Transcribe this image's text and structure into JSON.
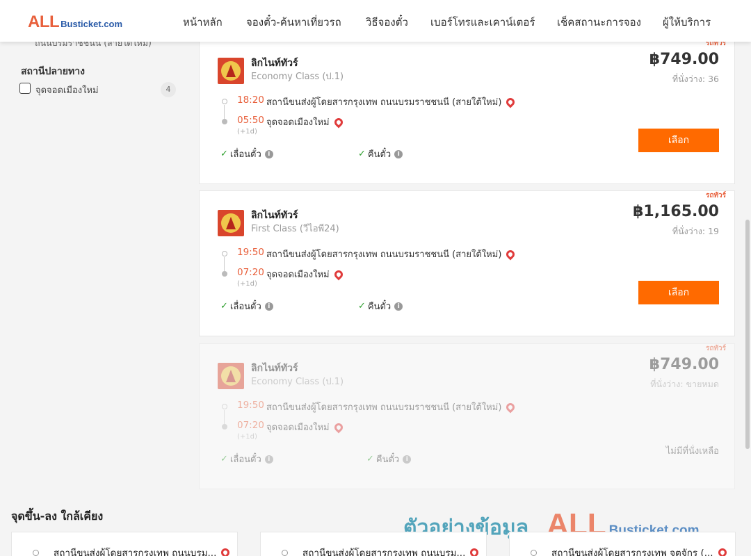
{
  "header": {
    "logo_all": "ALL",
    "logo_rest": "Busticket.com",
    "nav": [
      "หน้าหลัก",
      "จองตั๋ว-ค้นหาเที่ยวรถ",
      "วิธีจองตั๋ว",
      "เบอร์โทรและเคาน์เตอร์",
      "เช็คสถานะการจอง",
      "ผู้ให้บริการ"
    ]
  },
  "sidebar": {
    "cut_text": "ถนนบรมราชชนนี (สายใต้ใหม่)",
    "section_title": "สถานีปลายทาง",
    "option_label": "จุดจอดเมืองใหม่",
    "option_count": "4"
  },
  "trips": [
    {
      "tag": "รถทัวร์",
      "operator": "ลิกไนท์ทัวร์",
      "class": "Economy Class (ป.1)",
      "price": "฿749.00",
      "seats": "ที่นั่งว่าง: 36",
      "dep_time": "18:20",
      "dep_place": "สถานีขนส่งผู้โดยสารกรุงเทพ ถนนบรมราชชนนี (สายใต้ใหม่)",
      "arr_time": "05:50",
      "arr_place": "จุดจอดเมืองใหม่",
      "plus_day": "(+1d)",
      "feature_1": "เลื่อนตั๋ว",
      "feature_2": "คืนตั๋ว",
      "action": "เลือก"
    },
    {
      "tag": "รถทัวร์",
      "operator": "ลิกไนท์ทัวร์",
      "class": "First Class (วีไอพี24)",
      "price": "฿1,165.00",
      "seats": "ที่นั่งว่าง: 19",
      "dep_time": "19:50",
      "dep_place": "สถานีขนส่งผู้โดยสารกรุงเทพ ถนนบรมราชชนนี (สายใต้ใหม่)",
      "arr_time": "07:20",
      "arr_place": "จุดจอดเมืองใหม่",
      "plus_day": "(+1d)",
      "feature_1": "เลื่อนตั๋ว",
      "feature_2": "คืนตั๋ว",
      "action": "เลือก"
    },
    {
      "tag": "รถทัวร์",
      "operator": "ลิกไนท์ทัวร์",
      "class": "Economy Class (ป.1)",
      "price": "฿749.00",
      "seats": "ที่นั่งว่าง: ขายหมด",
      "dep_time": "19:50",
      "dep_place": "สถานีขนส่งผู้โดยสารกรุงเทพ ถนนบรมราชชนนี (สายใต้ใหม่)",
      "arr_time": "07:20",
      "arr_place": "จุดจอดเมืองใหม่",
      "plus_day": "(+1d)",
      "feature_1": "เลื่อนตั๋ว",
      "feature_2": "คืนตั๋ว",
      "status": "ไม่มีที่นั่งเหลือ"
    }
  ],
  "nearby": {
    "title": "จุดขึ้น-ลง ใกล้เคียง",
    "items": [
      "สถานีขนส่งผู้โดยสารกรุงเทพ ถนนบรม...",
      "สถานีขนส่งผู้โดยสารกรุงเทพ ถนนบรม...",
      "สถานีขนส่งผู้โดยสารกรุงเทพ จตุจักร (..."
    ]
  },
  "watermark": {
    "thai": "ตัวอย่างข้อมูล",
    "all": "ALL",
    "rest": "Busticket.com"
  },
  "colors": {
    "accent": "#ff6a00",
    "time": "#e8603c",
    "check": "#2a9d2a",
    "pin": "#e03b3b"
  }
}
